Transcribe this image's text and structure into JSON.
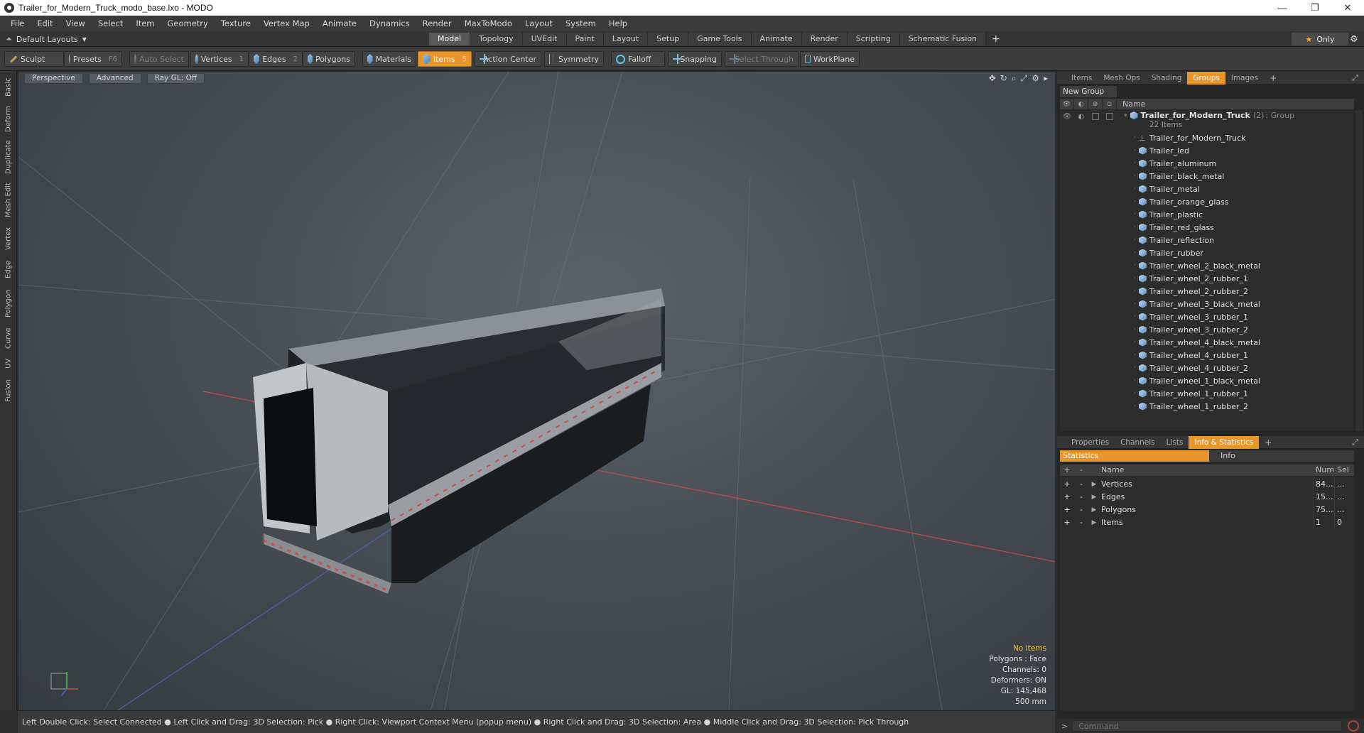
{
  "window": {
    "title": "Trailer_for_Modern_Truck_modo_base.lxo - MODO",
    "minimize": "—",
    "maximize": "❐",
    "close": "✕"
  },
  "menu": [
    "File",
    "Edit",
    "View",
    "Select",
    "Item",
    "Geometry",
    "Texture",
    "Vertex Map",
    "Animate",
    "Dynamics",
    "Render",
    "MaxToModo",
    "Layout",
    "System",
    "Help"
  ],
  "layoutbar": {
    "layouts_label": "Default Layouts",
    "tabs": [
      "Model",
      "Topology",
      "UVEdit",
      "Paint",
      "Layout",
      "Setup",
      "Game Tools",
      "Animate",
      "Render",
      "Scripting",
      "Schematic Fusion"
    ],
    "active_tab": "Model",
    "plus": "+",
    "only_label": "Only"
  },
  "toolbar": {
    "sculpt": "Sculpt",
    "presets": "Presets",
    "presets_key": "F6",
    "auto_select": "Auto Select",
    "vertices": "Vertices",
    "vertices_key": "1",
    "edges": "Edges",
    "edges_key": "2",
    "polygons": "Polygons",
    "materials": "Materials",
    "items": "Items",
    "items_key": "5",
    "action_center": "Action Center",
    "symmetry": "Symmetry",
    "falloff": "Falloff",
    "snapping": "Snapping",
    "select_through": "Select Through",
    "workplane": "WorkPlane"
  },
  "lefttabs": [
    "Basic",
    "Deform",
    "Duplicate",
    "Mesh Edit",
    "Vertex",
    "Edge",
    "Polygon",
    "Curve",
    "UV",
    "Fusion"
  ],
  "viewport": {
    "perspective": "Perspective",
    "advanced": "Advanced",
    "raygl": "Ray GL: Off",
    "info": {
      "selection": "No Items",
      "polygons": "Polygons : Face",
      "channels": "Channels: 0",
      "deformers": "Deformers: ON",
      "gl": "GL: 145,468",
      "scale": "500 mm"
    }
  },
  "statusbar": {
    "text": "Left Double Click: Select Connected ● Left Click and Drag: 3D Selection: Pick ● Right Click: Viewport Context Menu (popup menu) ● Right Click and Drag: 3D Selection: Area ● Middle Click and Drag: 3D Selection: Pick Through"
  },
  "groups_panel": {
    "tabs": [
      "Items",
      "Mesh Ops",
      "Shading",
      "Groups",
      "Images"
    ],
    "active_tab": "Groups",
    "plus": "+",
    "new_group": "New Group",
    "name_header": "Name",
    "group_name": "Trailer_for_Modern_Truck",
    "group_count": "(2)",
    "group_type": ": Group",
    "group_items": "22 Items",
    "items": [
      "Trailer_for_Modern_Truck",
      "Trailer_led",
      "Trailer_aluminum",
      "Trailer_black_metal",
      "Trailer_metal",
      "Trailer_orange_glass",
      "Trailer_plastic",
      "Trailer_red_glass",
      "Trailer_reflection",
      "Trailer_rubber",
      "Trailer_wheel_2_black_metal",
      "Trailer_wheel_2_rubber_1",
      "Trailer_wheel_2_rubber_2",
      "Trailer_wheel_3_black_metal",
      "Trailer_wheel_3_rubber_1",
      "Trailer_wheel_3_rubber_2",
      "Trailer_wheel_4_black_metal",
      "Trailer_wheel_4_rubber_1",
      "Trailer_wheel_4_rubber_2",
      "Trailer_wheel_1_black_metal",
      "Trailer_wheel_1_rubber_1",
      "Trailer_wheel_1_rubber_2"
    ]
  },
  "stats_panel": {
    "tabs": [
      "Properties",
      "Channels",
      "Lists",
      "Info & Statistics"
    ],
    "active_tab": "Info & Statistics",
    "plus": "+",
    "sub_statistics": "Statistics",
    "sub_info": "Info",
    "head_plus": "+",
    "head_minus": "-",
    "head_name": "Name",
    "head_num": "Num",
    "head_sel": "Sel",
    "rows": [
      {
        "name": "Vertices",
        "num": "84....",
        "sel": "..."
      },
      {
        "name": "Edges",
        "num": "15....",
        "sel": "..."
      },
      {
        "name": "Polygons",
        "num": "75....",
        "sel": "..."
      },
      {
        "name": "Items",
        "num": "1",
        "sel": "0"
      }
    ]
  },
  "command": {
    "prompt": ">",
    "placeholder": "Command"
  },
  "colors": {
    "accent": "#e8952a",
    "viewport_bg": "#474e54",
    "panel_bg": "#2c2c2c"
  }
}
